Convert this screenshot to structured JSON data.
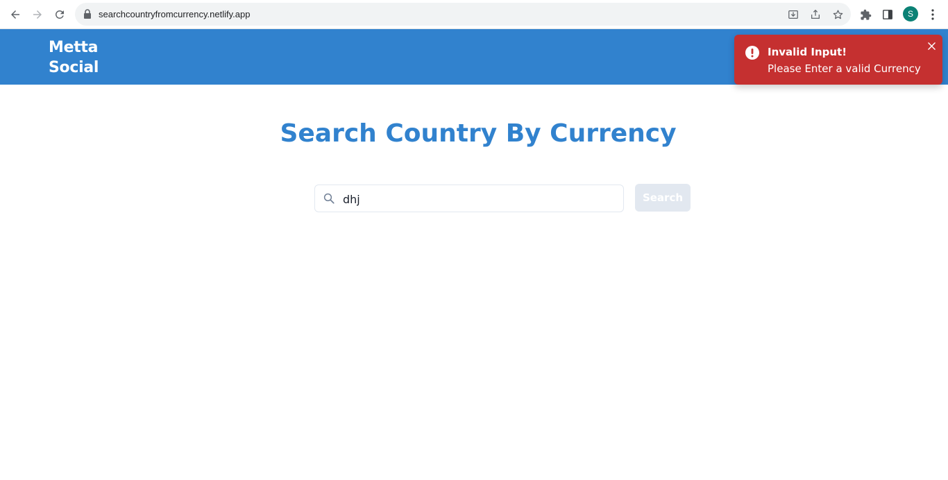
{
  "browser": {
    "url": "searchcountryfromcurrency.netlify.app",
    "profile_initial": "S"
  },
  "header": {
    "brand_line1": "Metta",
    "brand_line2": "Social"
  },
  "main": {
    "title": "Search Country By Currency",
    "search": {
      "value": "dhj",
      "placeholder": ""
    },
    "search_button_label": "Search"
  },
  "toast": {
    "title": "Invalid Input!",
    "description": "Please Enter a valid Currency"
  },
  "colors": {
    "brand_blue": "#3182ce",
    "toast_red": "#c53030",
    "button_disabled": "#e2e8f0"
  }
}
